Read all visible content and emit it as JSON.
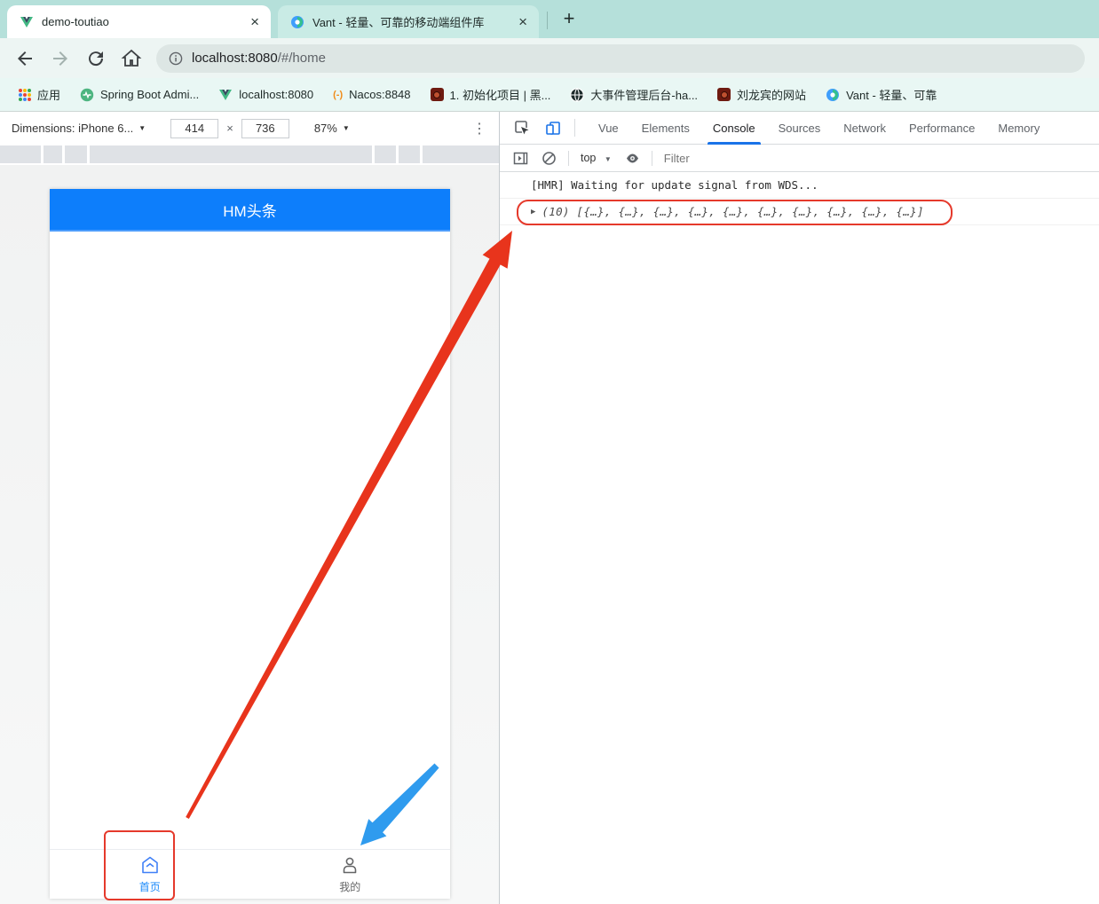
{
  "browser": {
    "tabs": [
      {
        "title": "demo-toutiao"
      },
      {
        "title": "Vant - 轻量、可靠的移动端组件库"
      }
    ],
    "close_glyph": "×",
    "new_tab_glyph": "+",
    "url_host": "localhost:8080",
    "url_path": "/#/home",
    "bookmarks": [
      {
        "label": "应用",
        "icon": "apps-grid-icon"
      },
      {
        "label": "Spring Boot Admi...",
        "icon": "spring-boot-icon"
      },
      {
        "label": "localhost:8080",
        "icon": "vue-icon"
      },
      {
        "label": "Nacos:8848",
        "icon": "nacos-icon",
        "glyph": "(-)"
      },
      {
        "label": "1. 初始化项目 | 黑...",
        "icon": "red-site-icon"
      },
      {
        "label": "大事件管理后台-ha...",
        "icon": "globe-icon"
      },
      {
        "label": "刘龙宾的网站",
        "icon": "red-site-icon"
      },
      {
        "label": "Vant - 轻量、可靠",
        "icon": "vant-icon"
      }
    ]
  },
  "devtools": {
    "device_toolbar": {
      "dimensions_label": "Dimensions: iPhone 6...",
      "width_value": "414",
      "times_glyph": "×",
      "height_value": "736",
      "zoom_value": "87%",
      "caret_glyph": "▼",
      "kebab_glyph": "⋮"
    },
    "tabs": [
      {
        "label": "Vue"
      },
      {
        "label": "Elements"
      },
      {
        "label": "Console"
      },
      {
        "label": "Sources"
      },
      {
        "label": "Network"
      },
      {
        "label": "Performance"
      },
      {
        "label": "Memory"
      }
    ],
    "active_tab": "Console",
    "console": {
      "context_value": "top",
      "caret_glyph": "▼",
      "filter_placeholder": "Filter",
      "messages": [
        {
          "text": "[HMR] Waiting for update signal from WDS..."
        },
        {
          "expander": "▶",
          "text": "(10) [{…}, {…}, {…}, {…}, {…}, {…}, {…}, {…}, {…}, {…}]"
        }
      ]
    }
  },
  "app": {
    "navbar_title": "HM头条",
    "tabbar": [
      {
        "label": "首页",
        "active": true
      },
      {
        "label": "我的",
        "active": false
      }
    ]
  },
  "colors": {
    "accent_blue": "#1989fa",
    "navbar_blue": "#0d7efb",
    "annotation_red": "#e5392b",
    "annotation_blue": "#2f9bee",
    "devtools_accent": "#1a73e8",
    "tabstrip_teal": "#b5e0da"
  }
}
